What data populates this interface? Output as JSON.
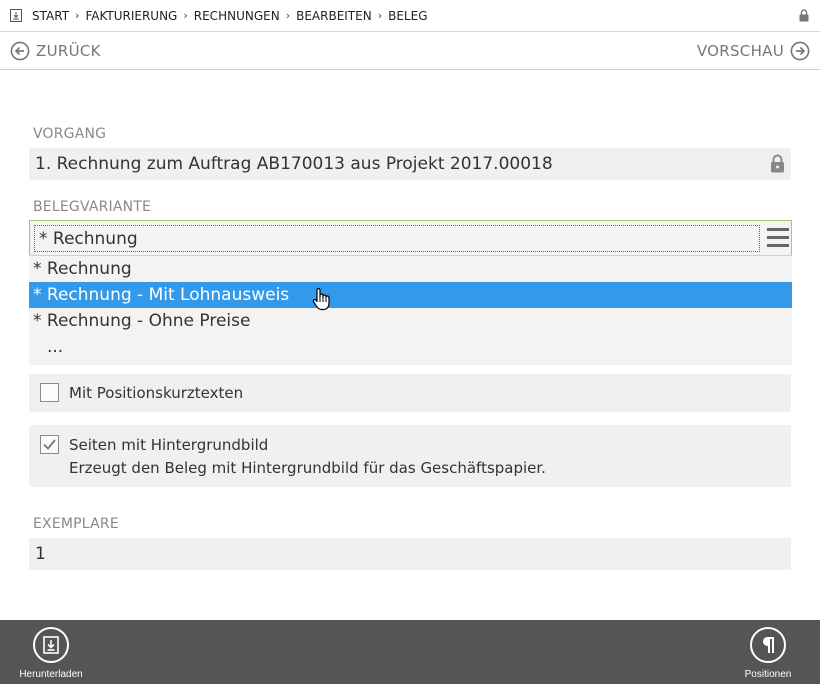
{
  "breadcrumb": {
    "items": [
      "START",
      "FAKTURIERUNG",
      "RECHNUNGEN",
      "BEARBEITEN",
      "BELEG"
    ]
  },
  "nav": {
    "back_label": "ZURÜCK",
    "forward_label": "VORSCHAU"
  },
  "vorgang": {
    "label": "VORGANG",
    "value": "1. Rechnung zum Auftrag AB170013 aus Projekt 2017.00018",
    "locked": true
  },
  "belegvariante": {
    "label": "BELEGVARIANTE",
    "value": "* Rechnung",
    "options": [
      {
        "label": "* Rechnung",
        "selected": false
      },
      {
        "label": "* Rechnung - Mit Lohnausweis",
        "selected": true
      },
      {
        "label": "* Rechnung - Ohne Preise",
        "selected": false
      },
      {
        "label": "...",
        "selected": false
      }
    ]
  },
  "positionskurztexte": {
    "label": "Mit Positionskurztexten",
    "checked": false
  },
  "hintergrundbild": {
    "label": "Seiten mit Hintergrundbild",
    "description": "Erzeugt den Beleg mit Hintergrundbild für das Geschäftspapier.",
    "checked": true
  },
  "exemplare": {
    "label": "EXEMPLARE",
    "value": "1"
  },
  "bottom": {
    "download_label": "Herunterladen",
    "positions_label": "Positionen"
  },
  "colors": {
    "accent_selected": "#3399e8",
    "combo_border": "#a5c86c",
    "bottom_bar": "#555555"
  },
  "icons": {
    "home": "download-box-icon",
    "top_lock": "lock-icon",
    "back": "arrow-left-circle-icon",
    "forward": "arrow-right-circle-icon",
    "field_lock": "lock-icon",
    "combo_menu": "hamburger-menu-icon",
    "download": "download-icon",
    "positions": "pilcrow-icon"
  }
}
